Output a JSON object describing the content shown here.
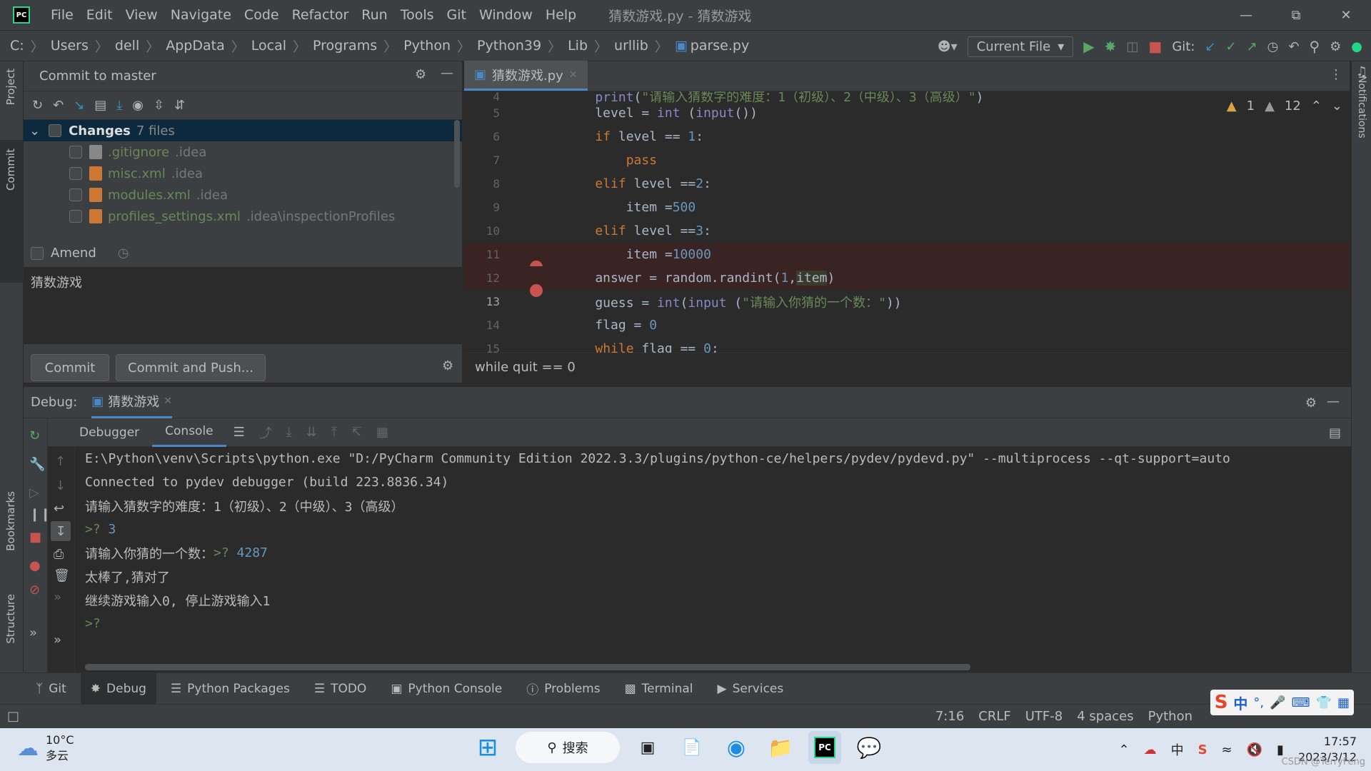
{
  "app": {
    "title": "猜数游戏.py - 猜数游戏",
    "logo": "PC"
  },
  "menu": [
    "File",
    "Edit",
    "View",
    "Navigate",
    "Code",
    "Refactor",
    "Run",
    "Tools",
    "Git",
    "Window",
    "Help"
  ],
  "breadcrumbs": [
    "C:",
    "Users",
    "dell",
    "AppData",
    "Local",
    "Programs",
    "Python",
    "Python39",
    "Lib",
    "urllib",
    "parse.py"
  ],
  "toolbar": {
    "run_config": "Current File",
    "git_label": "Git:"
  },
  "commit_panel": {
    "title": "Commit to master",
    "changes_label": "Changes",
    "changes_count": "7 files",
    "files": [
      {
        "name": ".gitignore",
        "dir": ".idea"
      },
      {
        "name": "misc.xml",
        "dir": ".idea"
      },
      {
        "name": "modules.xml",
        "dir": ".idea"
      },
      {
        "name": "profiles_settings.xml",
        "dir": ".idea\\inspectionProfiles"
      }
    ],
    "amend_label": "Amend",
    "message": "猜数游戏",
    "commit_button": "Commit",
    "commit_push_button": "Commit and Push..."
  },
  "editor": {
    "tab": "猜数游戏.py",
    "warnings_a": "1",
    "warnings_b": "12",
    "lines": [
      {
        "n": "4"
      },
      {
        "n": "5"
      },
      {
        "n": "6"
      },
      {
        "n": "7"
      },
      {
        "n": "8"
      },
      {
        "n": "9"
      },
      {
        "n": "10"
      },
      {
        "n": "11"
      },
      {
        "n": "12"
      },
      {
        "n": "13"
      },
      {
        "n": "14"
      },
      {
        "n": "15"
      }
    ],
    "code_breadcrumb": "while quit == 0"
  },
  "debug": {
    "label": "Debug:",
    "session_tab": "猜数游戏",
    "tabs": [
      "Debugger",
      "Console"
    ],
    "console": [
      "E:\\Python\\venv\\Scripts\\python.exe \"D:/PyCharm Community Edition 2022.3.3/plugins/python-ce/helpers/pydev/pydevd.py\" --multiprocess --qt-support=auto",
      "Connected to pydev debugger (build 223.8836.34)",
      "请输入猜数字的难度：1（初级）、2（中级）、3（高级）"
    ],
    "prompt1": ">? ",
    "input1": "3",
    "line_guess": "请输入你猜的一个数：",
    "prompt2": ">? ",
    "input2": "4287",
    "line_win": "太棒了,猜对了",
    "line_continue": "继续游戏输入0, 停止游戏输入1",
    "prompt3": ">?"
  },
  "tool_tabs": [
    "Git",
    "Debug",
    "Python Packages",
    "TODO",
    "Python Console",
    "Problems",
    "Terminal",
    "Services"
  ],
  "status": {
    "position": "7:16",
    "line_sep": "CRLF",
    "encoding": "UTF-8",
    "indent": "4 spaces",
    "interpreter": "Python"
  },
  "side_labels": {
    "project": "Project",
    "commit": "Commit",
    "bookmarks": "Bookmarks",
    "structure": "Structure",
    "notifications": "Notifications"
  },
  "taskbar": {
    "temp": "10°C",
    "weather": "多云",
    "search": "搜索",
    "time": "17:57",
    "date": "2023/3/12",
    "tray_lang": "中",
    "watermark": "CSDN @TerryFeng"
  },
  "ime": {
    "lang": "中"
  }
}
